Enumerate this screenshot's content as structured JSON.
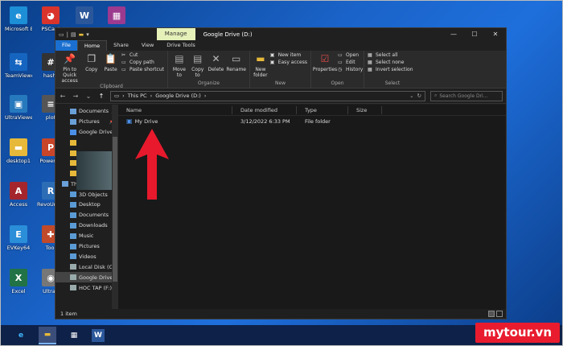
{
  "desktop_icons": [
    {
      "label": "Microsoft Edge",
      "glyph": "e",
      "color": "#1d8fd6"
    },
    {
      "label": "PSCapt",
      "glyph": "◕",
      "color": "#d9342b"
    },
    {
      "label": "",
      "glyph": "W",
      "color": "#2b579a"
    },
    {
      "label": "",
      "glyph": "▦",
      "color": "#9b3a8f"
    },
    {
      "label": "TeamViewer",
      "glyph": "⇆",
      "color": "#1565c0"
    },
    {
      "label": "hasht",
      "glyph": "#",
      "color": "#333"
    },
    {
      "label": "UltraViewer",
      "glyph": "▣",
      "color": "#2779bd"
    },
    {
      "label": "plot",
      "glyph": "≡",
      "color": "#555"
    },
    {
      "label": "desktop1",
      "glyph": "▬",
      "color": "#e6b93a"
    },
    {
      "label": "PowerPo",
      "glyph": "P",
      "color": "#c8452a"
    },
    {
      "label": "Access",
      "glyph": "A",
      "color": "#a4262c"
    },
    {
      "label": "RevoUnin Portab",
      "glyph": "R",
      "color": "#2d6db5"
    },
    {
      "label": "EVKey64",
      "glyph": "E",
      "color": "#2a8ed8"
    },
    {
      "label": "Tool",
      "glyph": "✚",
      "color": "#c04a2a"
    },
    {
      "label": "Excel",
      "glyph": "X",
      "color": "#217346"
    },
    {
      "label": "UltraS",
      "glyph": "◉",
      "color": "#777"
    }
  ],
  "window": {
    "title": "Google Drive (D:)",
    "manage_tab": "Manage",
    "controls": [
      "—",
      "☐",
      "✕"
    ]
  },
  "ribbon_tabs": [
    "File",
    "Home",
    "Share",
    "View",
    "Drive Tools"
  ],
  "ribbon": {
    "clipboard": {
      "name": "Clipboard",
      "pin": "Pin to Quick access",
      "copy": "Copy",
      "paste": "Paste",
      "cut": "Cut",
      "copy_path": "Copy path",
      "paste_shortcut": "Paste shortcut"
    },
    "organize": {
      "name": "Organize",
      "move_to": "Move to",
      "copy_to": "Copy to",
      "delete": "Delete",
      "rename": "Rename"
    },
    "new": {
      "name": "New",
      "new_folder": "New folder",
      "new_item": "New item",
      "easy_access": "Easy access"
    },
    "open": {
      "name": "Open",
      "properties": "Properties",
      "open": "Open",
      "edit": "Edit",
      "history": "History"
    },
    "select": {
      "name": "Select",
      "select_all": "Select all",
      "select_none": "Select none",
      "invert_selection": "Invert selection"
    }
  },
  "address": {
    "path_root": "This PC",
    "path_sep": "›",
    "path_current": "Google Drive (D:)",
    "search_placeholder": "Search Google Dri..."
  },
  "nav": {
    "quick": [
      {
        "label": "Documents",
        "pin": "📌"
      },
      {
        "label": "Pictures",
        "pin": "📌"
      },
      {
        "label": "Google Drive",
        "pin": "📌"
      }
    ],
    "this_pc": "This PC",
    "pc_items": [
      "3D Objects",
      "Desktop",
      "Documents",
      "Downloads",
      "Music",
      "Pictures",
      "Videos",
      "Local Disk (C:)",
      "Google Drive (D:)",
      "HOC TAP (F:)"
    ]
  },
  "columns": [
    "Name",
    "Date modified",
    "Type",
    "Size"
  ],
  "files": [
    {
      "name": "My Drive",
      "date": "3/12/2022 6:33 PM",
      "type": "File folder",
      "size": ""
    }
  ],
  "status": "1 item",
  "watermark": "mytour.vn",
  "colors": {
    "accent": "#1a6fd0",
    "arrow": "#e8192c",
    "folder": "#e6b93a"
  }
}
